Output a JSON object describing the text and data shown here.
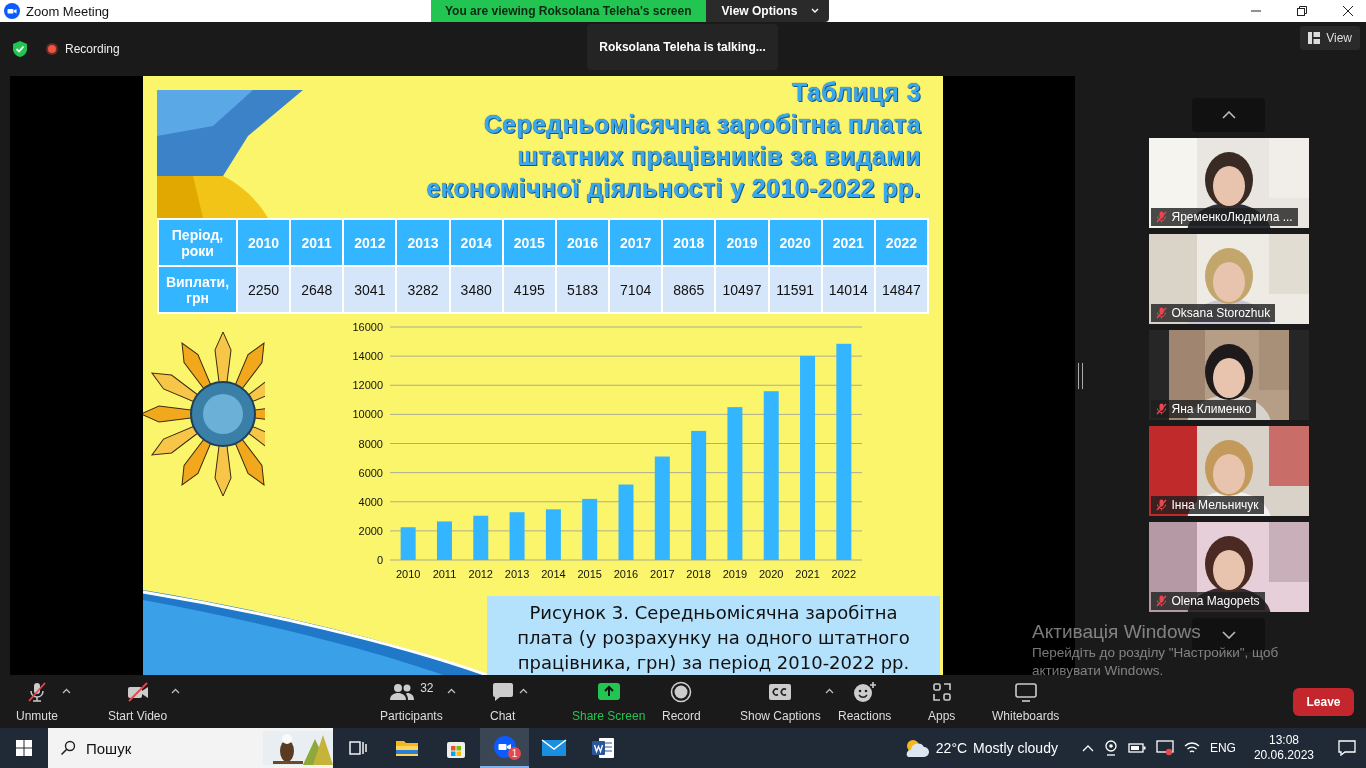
{
  "title_bar": {
    "app_title": "Zoom Meeting",
    "banner": "You are viewing Roksolana Teleha's screen",
    "view_options": "View Options"
  },
  "meeting_bar": {
    "recording": "Recording",
    "talking": "Roksolana Teleha is talking...",
    "view": "View"
  },
  "slide": {
    "table_label": "Таблиця 3",
    "title_lines": [
      "Середньомісячна заробітна плата",
      "штатних працівників за видами",
      "економічної діяльності у 2010-2022 рр."
    ],
    "table": {
      "row_headers": [
        "Період, роки",
        "Виплати, грн"
      ],
      "years": [
        "2010",
        "2011",
        "2012",
        "2013",
        "2014",
        "2015",
        "2016",
        "2017",
        "2018",
        "2019",
        "2020",
        "2021",
        "2022"
      ],
      "payments": [
        "2250",
        "2648",
        "3041",
        "3282",
        "3480",
        "4195",
        "5183",
        "7104",
        "8865",
        "10497",
        "11591",
        "14014",
        "14847"
      ]
    },
    "chart_data": {
      "type": "bar",
      "categories": [
        "2010",
        "2011",
        "2012",
        "2013",
        "2014",
        "2015",
        "2016",
        "2017",
        "2018",
        "2019",
        "2020",
        "2021",
        "2022"
      ],
      "values": [
        2250,
        2648,
        3041,
        3282,
        3480,
        4195,
        5183,
        7104,
        8865,
        10497,
        11591,
        14014,
        14847
      ],
      "ylim": [
        0,
        16000
      ],
      "grid": true,
      "yticks": [
        0,
        2000,
        4000,
        6000,
        8000,
        10000,
        12000,
        14000,
        16000
      ]
    },
    "caption": "Рисунок 3. Середньомісячна заробітна плата (у розрахунку на одного штатного працівника, грн) за період 2010-2022 рр."
  },
  "participants": [
    {
      "name": "ЯременкоЛюдмила ...",
      "muted": true
    },
    {
      "name": "Oksana Storozhuk",
      "muted": true
    },
    {
      "name": "Яна Клименко",
      "muted": true
    },
    {
      "name": "Інна Мельничук",
      "muted": true
    },
    {
      "name": "Olena Magopets",
      "muted": true
    }
  ],
  "toolbar": {
    "items": [
      {
        "kind": "mic",
        "label": "Unmute",
        "off": true,
        "menu": true
      },
      {
        "kind": "video",
        "label": "Start Video",
        "off": true,
        "menu": true
      },
      {
        "kind": "participants",
        "label": "Participants",
        "count": "32",
        "menu": true
      },
      {
        "kind": "chat",
        "label": "Chat",
        "menu": true
      },
      {
        "kind": "share",
        "label": "Share Screen",
        "menu": false
      },
      {
        "kind": "record",
        "label": "Record",
        "menu": false
      },
      {
        "kind": "captions",
        "label": "Show Captions",
        "menu": true
      },
      {
        "kind": "reactions",
        "label": "Reactions",
        "menu": false
      },
      {
        "kind": "apps",
        "label": "Apps",
        "menu": false
      },
      {
        "kind": "whiteboards",
        "label": "Whiteboards",
        "menu": false
      }
    ],
    "leave": "Leave"
  },
  "activation": {
    "title": "Активація Windows",
    "text": "Перейдіть до розділу \"Настройки\", щоб активувати Windows."
  },
  "taskbar": {
    "search": {
      "placeholder": "Пошук"
    },
    "apps": [
      {
        "kind": "taskview",
        "active": false
      },
      {
        "kind": "explorer",
        "active": false
      },
      {
        "kind": "store",
        "active": false
      },
      {
        "kind": "zoom",
        "active": true,
        "badge": "1"
      },
      {
        "kind": "mail",
        "active": false
      },
      {
        "kind": "word",
        "active": false
      }
    ],
    "weather": {
      "temp": "22°C",
      "text": "Mostly cloudy"
    },
    "lang": "ENG",
    "time": "13:08",
    "date": "20.06.2023"
  }
}
